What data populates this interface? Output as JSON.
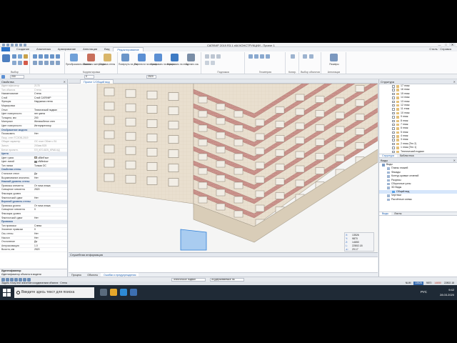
{
  "window": {
    "title": "САПФИР 2019 R3.1 x64 КОНСТРУКЦИИ - Проект 1"
  },
  "ribbon": {
    "tabs": [
      "Создание",
      "Аналитика",
      "Армирование",
      "Аннотации",
      "Вид",
      "Редактирование"
    ],
    "active_tab": "Редактирование",
    "right_tools": "Стиль · Справка",
    "buttons": {
      "b1": "Преобразовать объекты",
      "b2": "Заменить материалы",
      "b3": "Отделка стены",
      "b4": "Повернуть на угол",
      "b5": "Перенести на версию",
      "b6": "Копировать на версию",
      "b7": "Копировать на этаж",
      "b8": "Сделать ось",
      "b9": "Размеры"
    },
    "groups": {
      "g1": "Выбор",
      "g2": "Корректировка",
      "g3": "Подложка",
      "g4": "Геометрия",
      "g5": "Копир.",
      "g6": "Выбор объектов",
      "g7": "Аннотации"
    }
  },
  "options": {
    "field1": "200",
    "field2": "0",
    "field3": "2520"
  },
  "properties": {
    "header": "Свойства",
    "rows": [
      {
        "k": "Идентификатор",
        "v": "2178",
        "dim": true
      },
      {
        "k": "Тип объекта",
        "v": "Стена",
        "dim": true
      },
      {
        "k": "Наименование",
        "v": "Стена"
      },
      {
        "k": "Слой",
        "v": "Слой САПФИР"
      },
      {
        "k": "Функция",
        "v": "Наружная стена"
      },
      {
        "k": "Маркировка",
        "v": ""
      },
      {
        "k": "Отмл",
        "v": "Технический подвал"
      },
      {
        "k": "Цвет поверхности",
        "v": "нет цвета"
      },
      {
        "k": "Толщина, мм",
        "v": "200"
      },
      {
        "k": "Материал",
        "v": "Железобетон стен"
      },
      {
        "k": "Цвет поверхности",
        "v": "Интерпретатор"
      },
      {
        "sec": "Отображение",
        "k": "Отображение модели"
      },
      {
        "k": "Показывать",
        "v": "Нет"
      },
      {
        "k": "Покр. стен ТСЗОВ-2019",
        "v": "",
        "dim": true
      },
      {
        "k": "Общие характер.",
        "v": "ОС плит Облегч. В1",
        "dim": true
      },
      {
        "k": "Запол.",
        "v": "200мм В25",
        "dim": true
      },
      {
        "k": "Бетон проектн.",
        "v": "ПЛ_КГО-В25_КРАБ.КД",
        "dim": true
      },
      {
        "sec": "Цвета",
        "k": "Цвета"
      },
      {
        "k": "Цвет грани",
        "v": "clBtnFace",
        "sw": "#d9c9a8"
      },
      {
        "k": "Цвет линий",
        "v": "clWindow",
        "sw": "#6a6a6a"
      },
      {
        "k": "Тип линии",
        "v": "Тонкая ОС"
      },
      {
        "sec": "Свойства",
        "k": "Свойства стены"
      },
      {
        "k": "Стальное ствол",
        "v": "Да"
      },
      {
        "k": "Выравнивание аналитик.",
        "v": "Нет"
      },
      {
        "sec": "Нижний уровень стены",
        "k": "Нижний уровень стены"
      },
      {
        "k": "Привязка элемента",
        "v": "От низа этажа"
      },
      {
        "k": "Смещение элемента",
        "v": "2520"
      },
      {
        "k": "Фиксация уровня",
        "v": ""
      },
      {
        "k": "Фактический сдвиг",
        "v": "Нет"
      },
      {
        "sec": "Верхний уровень стены",
        "k": "Верхний уровень стены"
      },
      {
        "k": "Привязка уровня",
        "v": "От низа этажа"
      },
      {
        "k": "Смещение элемента",
        "v": "0"
      },
      {
        "k": "Фиксация уровня",
        "v": ""
      },
      {
        "k": "Фактический сдвиг",
        "v": "Нет"
      },
      {
        "sec": "Привязка",
        "k": "Привязка"
      },
      {
        "k": "Тип привязки",
        "v": "Слева"
      },
      {
        "k": "Значение привязки",
        "v": "0"
      },
      {
        "k": "Ось стены",
        "v": "Нет"
      },
      {
        "k": "Наклон",
        "v": "Нет"
      },
      {
        "k": "Отклонение",
        "v": "Да"
      },
      {
        "k": "Аппроксимация",
        "v": "1.0"
      },
      {
        "k": "Высота, мм",
        "v": "2520"
      }
    ],
    "footer_title": "Идентификатор",
    "footer_text": "Идентификатор объекта в модели"
  },
  "document": {
    "tab": "Проект 1/Общий вид"
  },
  "viewport": {
    "axis_label": "Z"
  },
  "coords": {
    "x": "13526",
    "y": "9870",
    "z": "14650",
    "l": "22802.18",
    "a": "29.17"
  },
  "info": {
    "header": "Служебная информация",
    "tabs": [
      "Процесс",
      "Объекты",
      "Ошибки и предупреждения"
    ],
    "active": "Ошибки и предупреждения"
  },
  "structure": {
    "header": "Структура",
    "floors": [
      "17 этаж",
      "16 этаж",
      "15 этаж",
      "14 этаж",
      "13 этаж",
      "12 этаж",
      "11 этаж",
      "10 этаж",
      "9 этаж",
      "8 этаж",
      "7 этаж",
      "6 этаж",
      "5 этаж",
      "4 этаж",
      "3 этаж",
      "2 этаж (Тех 2)",
      "1 этаж (Тех 1)",
      "Технический подвал"
    ],
    "tabs": [
      "Структура",
      "Библиотека"
    ]
  },
  "views": {
    "header": "Виды",
    "items": [
      {
        "label": "Виды",
        "lvl": 0
      },
      {
        "label": "Планы этажей",
        "lvl": 1
      },
      {
        "label": "Фасады",
        "lvl": 1
      },
      {
        "label": "Контур-кривые сечений",
        "lvl": 1
      },
      {
        "label": "Разрезы",
        "lvl": 1
      },
      {
        "label": "Сборочные узлы",
        "lvl": 1
      },
      {
        "label": "3D Виды",
        "lvl": 1
      },
      {
        "label": "Общий вид",
        "lvl": 2,
        "sel": true
      },
      {
        "label": "Чертежи",
        "lvl": 1
      },
      {
        "label": "Расчётные схемы",
        "lvl": 1
      }
    ],
    "tabs": [
      "Виды",
      "Листы"
    ]
  },
  "bottombar": {
    "f1": "Техническое подвал",
    "f2": "Ж/удерживаемые на"
  },
  "statusbar": {
    "left": "Задать точку или значение координатами объекта · Стена",
    "right": [
      "NUM",
      "13526",
      "9870",
      "14650",
      "22802.18"
    ]
  },
  "taskbar": {
    "search_placeholder": "Введите здесь текст для поиска",
    "time": "9:42",
    "date": "28.03.2020",
    "lang": "РУС"
  },
  "colors": {
    "accent": "#2c73c9",
    "brick": "#c8908a",
    "facade": "#e6dccc",
    "selection": "#5aa2e6"
  }
}
